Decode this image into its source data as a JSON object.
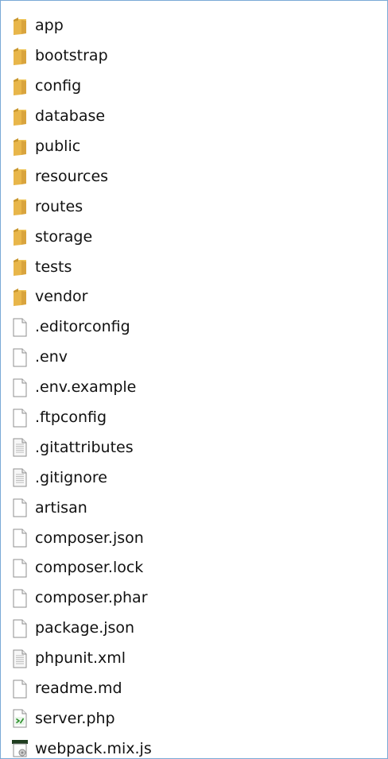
{
  "items": [
    {
      "name": "app",
      "kind": "folder",
      "icon": "folder-icon"
    },
    {
      "name": "bootstrap",
      "kind": "folder",
      "icon": "folder-icon"
    },
    {
      "name": "config",
      "kind": "folder",
      "icon": "folder-icon"
    },
    {
      "name": "database",
      "kind": "folder",
      "icon": "folder-icon"
    },
    {
      "name": "public",
      "kind": "folder",
      "icon": "folder-icon"
    },
    {
      "name": "resources",
      "kind": "folder",
      "icon": "folder-icon"
    },
    {
      "name": "routes",
      "kind": "folder",
      "icon": "folder-icon"
    },
    {
      "name": "storage",
      "kind": "folder",
      "icon": "folder-icon"
    },
    {
      "name": "tests",
      "kind": "folder",
      "icon": "folder-icon"
    },
    {
      "name": "vendor",
      "kind": "folder",
      "icon": "folder-icon"
    },
    {
      "name": ".editorconfig",
      "kind": "file",
      "icon": "file-icon"
    },
    {
      "name": ".env",
      "kind": "file",
      "icon": "file-icon"
    },
    {
      "name": ".env.example",
      "kind": "file",
      "icon": "file-icon"
    },
    {
      "name": ".ftpconfig",
      "kind": "file",
      "icon": "file-icon"
    },
    {
      "name": ".gitattributes",
      "kind": "text",
      "icon": "text-file-icon"
    },
    {
      "name": ".gitignore",
      "kind": "text",
      "icon": "text-file-icon"
    },
    {
      "name": "artisan",
      "kind": "file",
      "icon": "file-icon"
    },
    {
      "name": "composer.json",
      "kind": "file",
      "icon": "file-icon"
    },
    {
      "name": "composer.lock",
      "kind": "file",
      "icon": "file-icon"
    },
    {
      "name": "composer.phar",
      "kind": "file",
      "icon": "file-icon"
    },
    {
      "name": "package.json",
      "kind": "file",
      "icon": "file-icon"
    },
    {
      "name": "phpunit.xml",
      "kind": "text",
      "icon": "text-file-icon"
    },
    {
      "name": "readme.md",
      "kind": "file",
      "icon": "file-icon"
    },
    {
      "name": "server.php",
      "kind": "php",
      "icon": "php-file-icon"
    },
    {
      "name": "webpack.mix.js",
      "kind": "script",
      "icon": "script-file-icon"
    }
  ],
  "colors": {
    "border": "#7aa9d6",
    "folder": "#e8b64a",
    "folder_dark": "#c8962e",
    "php_green": "#2a8f2a",
    "script_dark": "#1f3d1f"
  }
}
